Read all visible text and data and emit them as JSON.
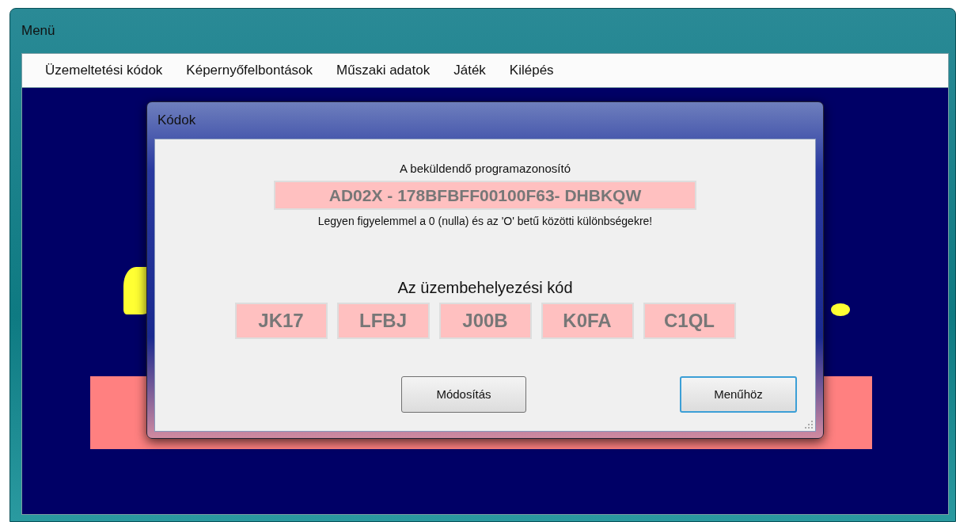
{
  "window": {
    "title": "Menü"
  },
  "menu": [
    {
      "label": "Üzemeltetési kódok"
    },
    {
      "label": "Képernyőfelbontások"
    },
    {
      "label": "Műszaki adatok"
    },
    {
      "label": "Játék"
    },
    {
      "label": "Kilépés"
    }
  ],
  "dialog": {
    "title": "Kódok",
    "program_id_label": "A beküldendő programazonosító",
    "program_id": "AD02X - 178BFBFF00100F63- DHBKQW",
    "warning": "Legyen figyelemmel a 0 (nulla) és az 'O' betű közötti különbségekre!",
    "activation_label": "Az üzembehelyezési kód",
    "activation_codes": [
      "JK17",
      "LFBJ",
      "J00B",
      "K0FA",
      "C1QL"
    ],
    "buttons": [
      {
        "label": "Módosítás",
        "default": false
      },
      {
        "label": "Menűhöz",
        "default": true
      }
    ]
  }
}
